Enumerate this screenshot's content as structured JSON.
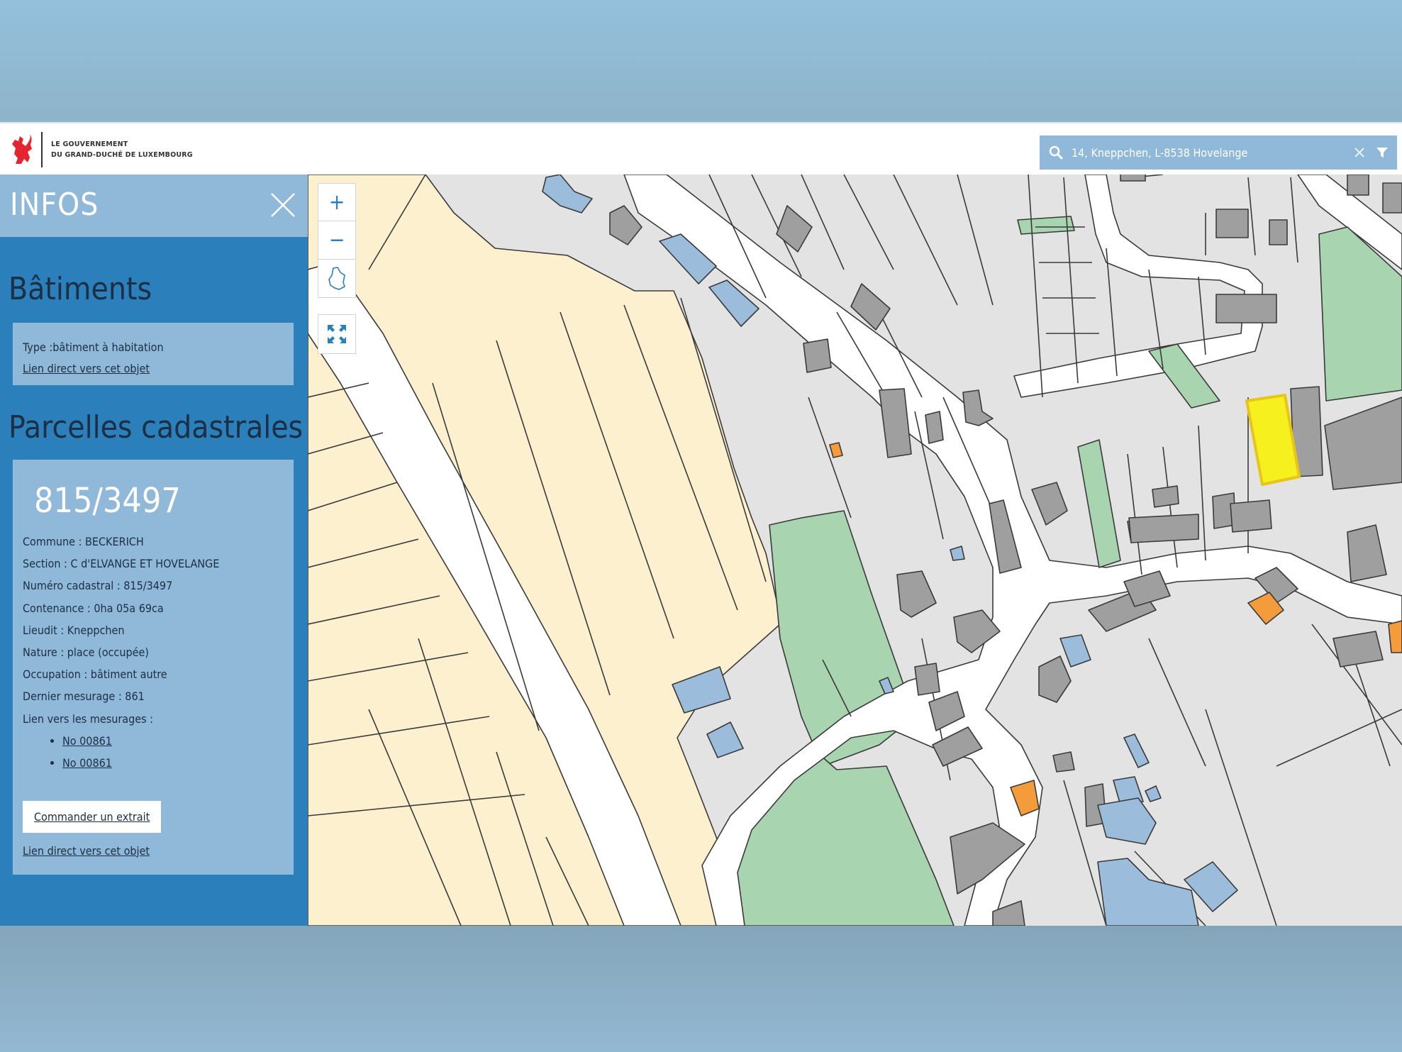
{
  "header": {
    "logo_line1": "LE GOUVERNEMENT",
    "logo_line2": "DU GRAND-DUCHÉ DE LUXEMBOURG",
    "search_value": "14, Kneppchen, L-8538 Hovelange",
    "icons": [
      "lion-icon",
      "search-icon",
      "clear-icon",
      "filter-icon"
    ]
  },
  "panel": {
    "title": "INFOS",
    "batiments": {
      "heading": "Bâtiments",
      "type": "Type :bâtiment à habitation",
      "link": "Lien direct vers cet objet"
    },
    "parcelles": {
      "heading": "Parcelles cadastrales",
      "number": "815/3497",
      "commune": "Commune : BECKERICH",
      "section": "Section : C d'ELVANGE ET HOVELANGE",
      "numero": "Numéro cadastral : 815/3497",
      "contenance": "Contenance : 0ha 05a 69ca",
      "lieudit": "Lieudit : Kneppchen",
      "nature": "Nature : place (occupée)",
      "occupation": "Occupation : bâtiment autre",
      "dernier": "Dernier mesurage : 861",
      "lien_mesurages": "Lien vers les mesurages :",
      "mesurages": [
        "No 00861",
        "No 00861"
      ],
      "order_button": "Commander un extrait",
      "link": "Lien direct vers cet objet"
    }
  },
  "map_controls": {
    "zoom_in": "+",
    "zoom_out": "−"
  },
  "colors": {
    "panel": "#2b7fba",
    "panel_light": "#8fb8d9",
    "agri": "#fdf0cf",
    "green": "#a8d4b0",
    "parcel": "#e3e3e3",
    "building": "#9f9f9f",
    "public": "#9bbddb",
    "special": "#f49b3c",
    "highlight": "#f5f01e"
  }
}
